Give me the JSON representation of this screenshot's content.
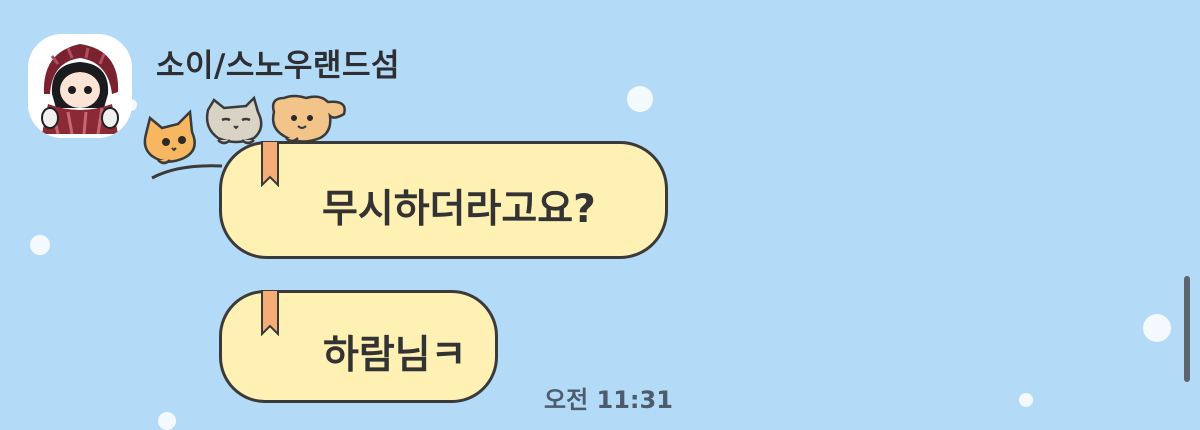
{
  "chat": {
    "sender_name": "소이/스노우랜드섬",
    "messages": [
      {
        "text": "무시하더라고요?"
      },
      {
        "text": "하람님ㅋ"
      }
    ],
    "timestamp": "오전 11:31"
  },
  "colors": {
    "background": "#b3daf6",
    "bubble_fill": "#fff1b4",
    "bubble_border": "#3a3a3a",
    "ribbon": "#f4ad77"
  },
  "icons": {
    "avatar": "profile-avatar-girl-scarf",
    "sticker": "three-peeking-cats-icon"
  }
}
